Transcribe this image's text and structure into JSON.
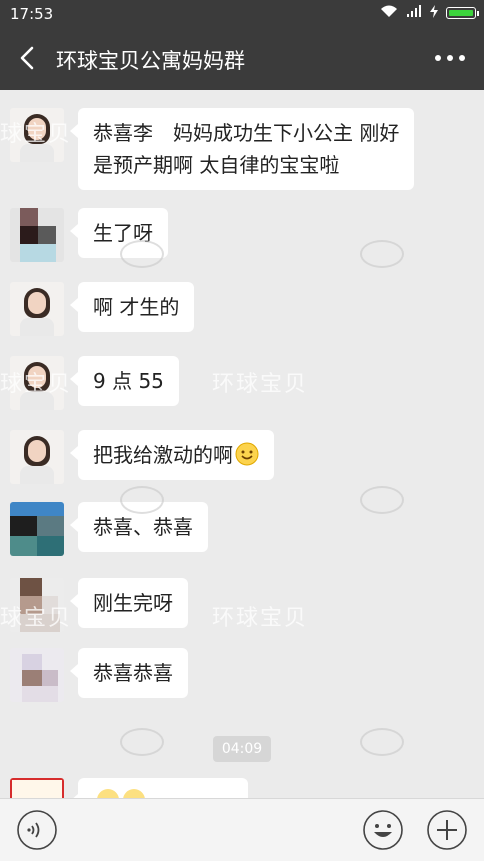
{
  "status": {
    "time": "17:53"
  },
  "header": {
    "title": "环球宝贝公寓妈妈群"
  },
  "messages": [
    {
      "lines": [
        "恭喜李　妈妈成功生下小公主 刚好",
        "是预产期啊 太自律的宝宝啦"
      ]
    },
    {
      "text": "生了呀"
    },
    {
      "text": "啊 才生的"
    },
    {
      "text": "9 点 55"
    },
    {
      "text": "把我给激动的啊"
    },
    {
      "text": "恭喜、恭喜"
    },
    {
      "text": "刚生完呀"
    },
    {
      "text": "恭喜恭喜"
    }
  ],
  "timestamp": "04:09",
  "watermark": {
    "text": "环球宝贝",
    "partial_left": "球宝贝"
  },
  "icons": {
    "back": "back-arrow-icon",
    "more": "more-dots-icon",
    "voice": "voice-icon",
    "emoji": "emoji-icon",
    "add": "plus-icon"
  },
  "colors": {
    "header": "#3b3b3b",
    "chat_bg": "#ebebeb",
    "battery": "#3cd33c"
  }
}
